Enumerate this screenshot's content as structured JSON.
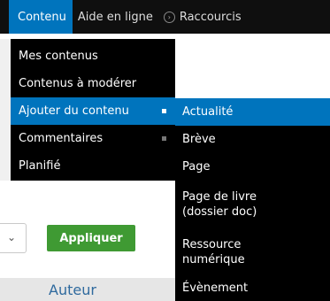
{
  "toolbar": {
    "items": [
      {
        "label": "Contenu"
      },
      {
        "label": "Aide en ligne"
      },
      {
        "label": "Raccourcis"
      }
    ]
  },
  "menu": {
    "items": [
      {
        "label": "Mes contenus"
      },
      {
        "label": "Contenus à modérer"
      },
      {
        "label": "Ajouter du contenu"
      },
      {
        "label": "Commentaires"
      },
      {
        "label": "Planifié"
      }
    ]
  },
  "submenu": {
    "items": [
      {
        "label": "Actualité"
      },
      {
        "label": "Brève"
      },
      {
        "label": "Page"
      },
      {
        "label": "Page de livre\n(dossier doc)"
      },
      {
        "label": "Ressource\nnumérique"
      },
      {
        "label": "Évènement"
      }
    ]
  },
  "page": {
    "apply_button": "Appliquer",
    "column_author": "Auteur"
  },
  "colors": {
    "accent": "#0074bd",
    "toolbar_bg": "#0f0f0f",
    "menu_bg": "#000000",
    "apply_green": "#3f9a33",
    "link_blue": "#2f6a9e"
  }
}
